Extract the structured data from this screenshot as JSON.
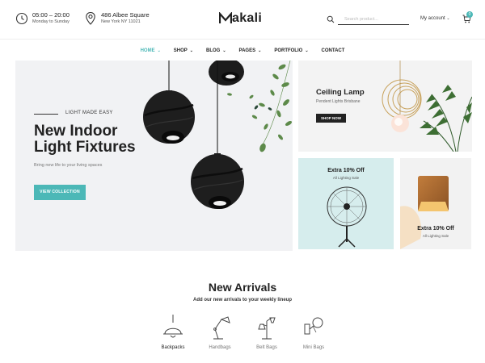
{
  "header": {
    "hours": {
      "line1": "05:00 – 20:00",
      "line2": "Monday to Sunday",
      "icon": "clock-icon"
    },
    "address": {
      "line1": "486 Albee Square",
      "line2": "New York NY 11021",
      "icon": "location-pin-icon"
    },
    "logo": "akali",
    "search_placeholder": "Search product...",
    "account_label": "My account",
    "cart_count": "0"
  },
  "nav": {
    "items": [
      {
        "label": "HOME",
        "active": true
      },
      {
        "label": "SHOP"
      },
      {
        "label": "BLOG"
      },
      {
        "label": "PAGES"
      },
      {
        "label": "PORTFOLIO"
      },
      {
        "label": "CONTACT"
      }
    ]
  },
  "hero": {
    "eyebrow": "LIGHT MADE EASY",
    "title_line1": "New Indoor",
    "title_line2": "Light Fixtures",
    "subtitle": "Bring new life to your living spaces",
    "button": "VIEW COLLECTION"
  },
  "banner_lamp": {
    "title": "Ceiling Lamp",
    "subtitle": "Pendent Lights Brisbane",
    "button": "SHOP NOW"
  },
  "banner_fan": {
    "title": "Extra 10% Off",
    "subtitle": "All Lighting Sale"
  },
  "banner_wall": {
    "title": "Extra 10% Off",
    "subtitle": "All Lighting Sale"
  },
  "arrivals": {
    "title": "New Arrivals",
    "subtitle": "Add our new arrivals to your weekly lineup",
    "categories": [
      "Backpacks",
      "Handbags",
      "Belt Bags",
      "Mini Bags"
    ]
  },
  "colors": {
    "accent": "#4cb8b7",
    "dark": "#222222"
  }
}
